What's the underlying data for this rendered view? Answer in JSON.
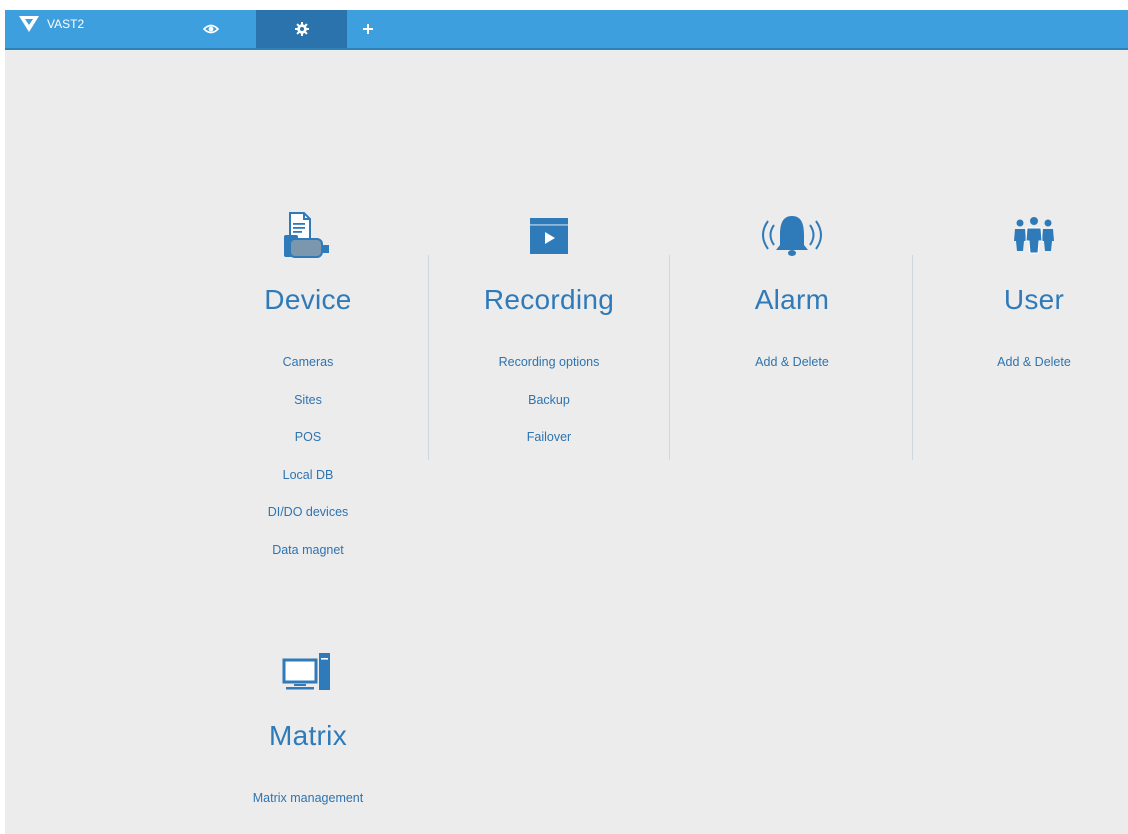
{
  "header": {
    "app_name": "VAST2",
    "tabs": [
      {
        "icon": "eye-icon"
      },
      {
        "icon": "gear-icon",
        "active": true
      },
      {
        "icon": "plus-icon"
      }
    ]
  },
  "colors": {
    "topbar": "#3d9fdd",
    "active_tab": "#2a73ad",
    "accent": "#2f7ab9",
    "background": "#ececec"
  },
  "sections": {
    "device": {
      "icon": "device-icon",
      "title": "Device",
      "links": [
        "Cameras",
        "Sites",
        "POS",
        "Local DB",
        "DI/DO devices",
        "Data magnet"
      ]
    },
    "recording": {
      "icon": "recording-icon",
      "title": "Recording",
      "links": [
        "Recording options",
        "Backup",
        "Failover"
      ]
    },
    "alarm": {
      "icon": "alarm-bell-icon",
      "title": "Alarm",
      "links": [
        "Add & Delete"
      ]
    },
    "user": {
      "icon": "users-icon",
      "title": "User",
      "links": [
        "Add & Delete"
      ]
    },
    "matrix": {
      "icon": "computer-icon",
      "title": "Matrix",
      "links": [
        "Matrix management"
      ]
    }
  }
}
